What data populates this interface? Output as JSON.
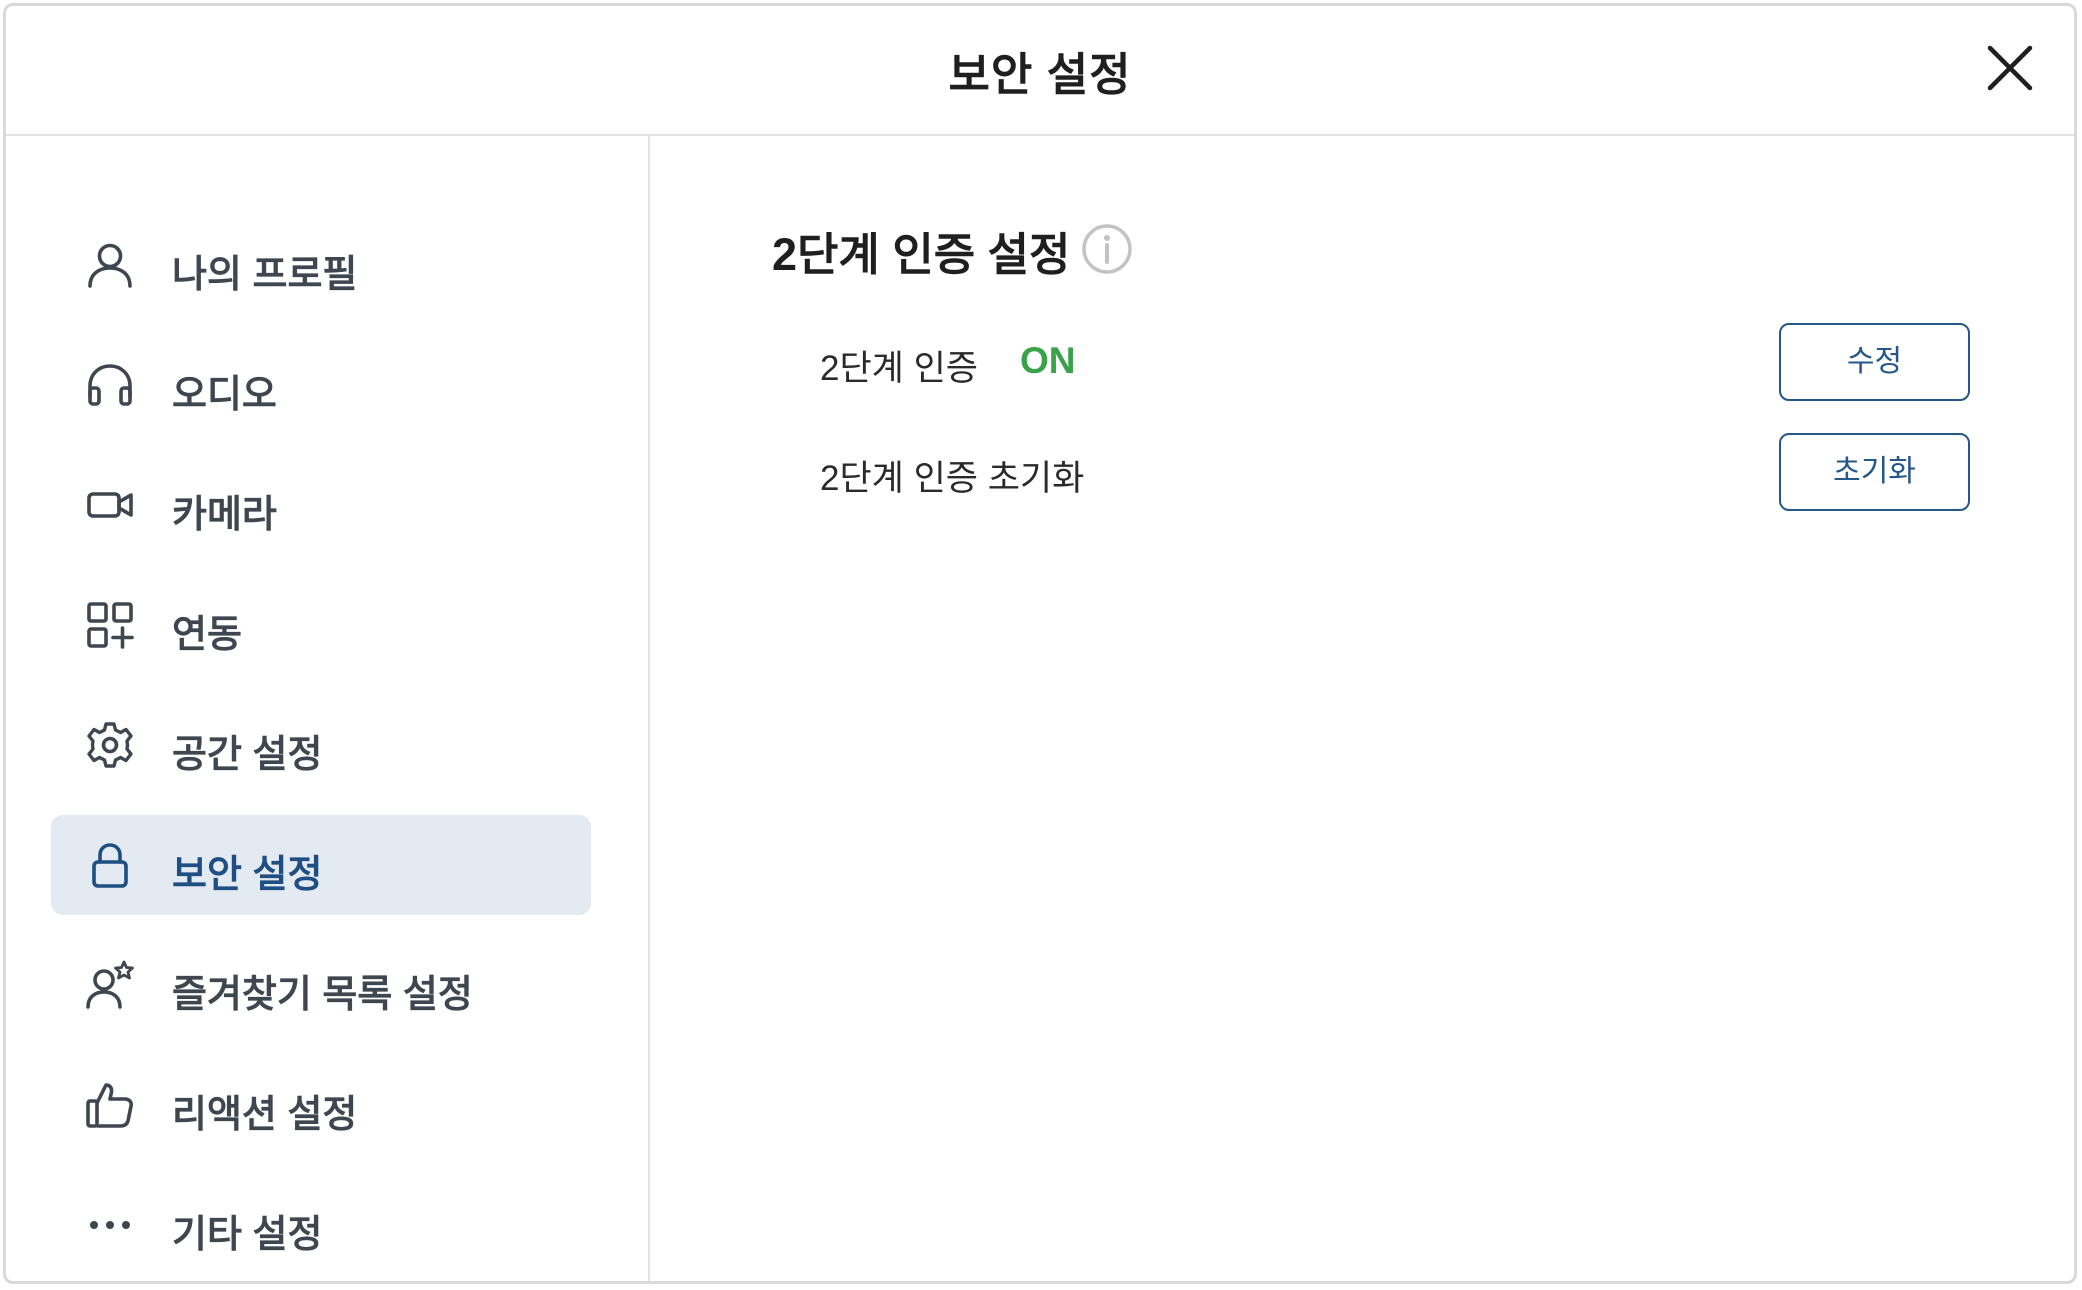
{
  "header": {
    "title": "보안 설정",
    "close_icon": "close-icon"
  },
  "sidebar": {
    "items": [
      {
        "label": "나의 프로필",
        "icon": "user-icon"
      },
      {
        "label": "오디오",
        "icon": "headphones-icon"
      },
      {
        "label": "카메라",
        "icon": "video-camera-icon"
      },
      {
        "label": "연동",
        "icon": "apps-add-icon"
      },
      {
        "label": "공간 설정",
        "icon": "gear-icon"
      },
      {
        "label": "보안 설정",
        "icon": "lock-icon",
        "active": true
      },
      {
        "label": "즐겨찾기 목록 설정",
        "icon": "user-star-icon"
      },
      {
        "label": "리액션 설정",
        "icon": "thumbs-up-icon"
      },
      {
        "label": "기타 설정",
        "icon": "more-icon"
      }
    ]
  },
  "main": {
    "section_title": "2단계 인증 설정",
    "info_icon": "info-icon",
    "rows": [
      {
        "label": "2단계 인증",
        "status": "ON",
        "button": "수정"
      },
      {
        "label": "2단계 인증 초기화",
        "button": "초기화"
      }
    ]
  },
  "colors": {
    "accent": "#25578a",
    "active_bg": "#e4eaf2",
    "status_on": "#3aa34a",
    "text_dark": "#1f1f1f",
    "nav_text": "#3e4650",
    "border": "#d9d9d9"
  }
}
